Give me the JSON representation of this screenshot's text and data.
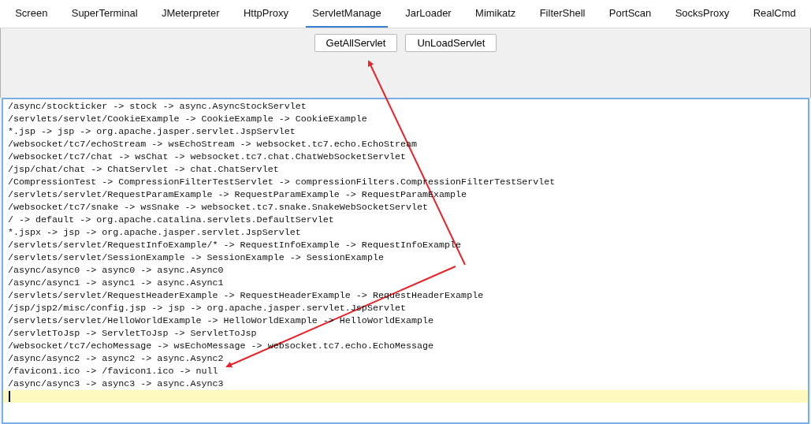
{
  "tabs": [
    {
      "label": "Screen",
      "selected": false
    },
    {
      "label": "SuperTerminal",
      "selected": false
    },
    {
      "label": "JMeterpreter",
      "selected": false
    },
    {
      "label": "HttpProxy",
      "selected": false
    },
    {
      "label": "ServletManage",
      "selected": true
    },
    {
      "label": "JarLoader",
      "selected": false
    },
    {
      "label": "Mimikatz",
      "selected": false
    },
    {
      "label": "FilterShell",
      "selected": false
    },
    {
      "label": "PortScan",
      "selected": false
    },
    {
      "label": "SocksProxy",
      "selected": false
    },
    {
      "label": "RealCmd",
      "selected": false
    }
  ],
  "buttons": [
    "GetAllServlet",
    "UnLoadServlet"
  ],
  "output_lines": [
    "/async/stockticker -> stock -> async.AsyncStockServlet",
    "/servlets/servlet/CookieExample -> CookieExample -> CookieExample",
    "*.jsp -> jsp -> org.apache.jasper.servlet.JspServlet",
    "/websocket/tc7/echoStream -> wsEchoStream -> websocket.tc7.echo.EchoStream",
    "/websocket/tc7/chat -> wsChat -> websocket.tc7.chat.ChatWebSocketServlet",
    "/jsp/chat/chat -> ChatServlet -> chat.ChatServlet",
    "/CompressionTest -> CompressionFilterTestServlet -> compressionFilters.CompressionFilterTestServlet",
    "/servlets/servlet/RequestParamExample -> RequestParamExample -> RequestParamExample",
    "/websocket/tc7/snake -> wsSnake -> websocket.tc7.snake.SnakeWebSocketServlet",
    "/ -> default -> org.apache.catalina.servlets.DefaultServlet",
    "*.jspx -> jsp -> org.apache.jasper.servlet.JspServlet",
    "/servlets/servlet/RequestInfoExample/* -> RequestInfoExample -> RequestInfoExample",
    "/servlets/servlet/SessionExample -> SessionExample -> SessionExample",
    "/async/async0 -> async0 -> async.Async0",
    "/async/async1 -> async1 -> async.Async1",
    "/servlets/servlet/RequestHeaderExample -> RequestHeaderExample -> RequestHeaderExample",
    "/jsp/jsp2/misc/config.jsp -> jsp -> org.apache.jasper.servlet.JspServlet",
    "/servlets/servlet/HelloWorldExample -> HelloWorldExample -> HelloWorldExample",
    "/servletToJsp -> ServletToJsp -> ServletToJsp",
    "/websocket/tc7/echoMessage -> wsEchoMessage -> websocket.tc7.echo.EchoMessage",
    "/async/async2 -> async2 -> async.Async2",
    "/favicon1.ico -> /favicon1.ico -> null",
    "/async/async3 -> async3 -> async.Async3"
  ]
}
